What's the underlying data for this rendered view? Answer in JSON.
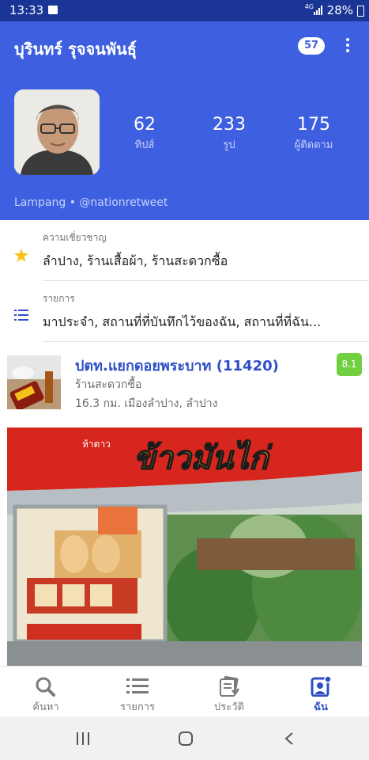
{
  "status": {
    "time": "13:33",
    "network": "4G",
    "battery": "28%"
  },
  "app_bar": {
    "title": "บุรินทร์ รุจจนพันธุ์",
    "notification_count": "57"
  },
  "profile": {
    "stats": [
      {
        "value": "62",
        "label": "ทิปส์"
      },
      {
        "value": "233",
        "label": "รูป"
      },
      {
        "value": "175",
        "label": "ผู้ติดตาม"
      }
    ],
    "location": "Lampang • @nationretweet"
  },
  "expertise": {
    "label": "ความเชี่ยวชาญ",
    "value": "ลำปาง, ร้านเสื้อผ้า, ร้านสะดวกซื้อ"
  },
  "lists": {
    "label": "รายการ",
    "value": "มาประจำ, สถานที่ที่บันทึกไว้ของฉัน, สถานที่ที่ฉัน..."
  },
  "venue": {
    "name": "ปตท.แยกดอยพระบาท (11420)",
    "category": "ร้านสะดวกซื้อ",
    "location": "16.3 กม.  เมืองลำปาง, ลำปาง",
    "score": "8.1",
    "sign_text": "ข้าวมันไก่",
    "sign_brand": "ห้าดาว"
  },
  "bottom_nav": [
    {
      "label": "ค้นหา",
      "icon": "search-icon"
    },
    {
      "label": "รายการ",
      "icon": "list-icon"
    },
    {
      "label": "ประวัติ",
      "icon": "history-icon"
    },
    {
      "label": "ฉัน",
      "icon": "profile-icon"
    }
  ],
  "colors": {
    "primary": "#3d5fe0",
    "status_bar": "#1a3596",
    "score": "#73cf42",
    "link": "#2f4fc6"
  }
}
